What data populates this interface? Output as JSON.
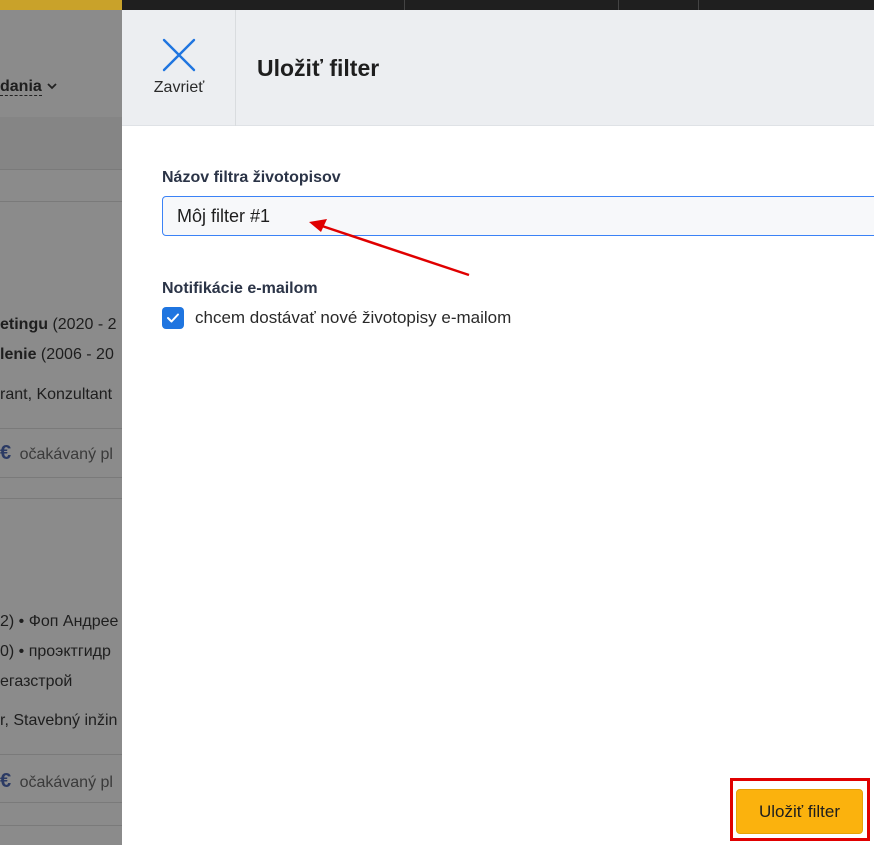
{
  "background_page": {
    "sort_label": "dania",
    "lines": [
      {
        "bold": "etingu",
        "rest": " (2020 - 2"
      },
      {
        "bold": "lenie",
        "rest": " (2006 - 20"
      },
      {
        "bold": "",
        "rest": "rant, Konzultant"
      },
      {
        "bold": "",
        "rest": "2) • Фоп Андрее"
      },
      {
        "bold": "",
        "rest": "0) • проэктгидр"
      },
      {
        "bold": "",
        "rest": "егазстрой"
      },
      {
        "bold": "",
        "rest": "r, Stavebný inžin"
      }
    ],
    "salary_label_1": "očakávaný pl",
    "salary_label_2": "očakávaný pl",
    "currency_symbol": "€"
  },
  "modal": {
    "close_label": "Zavrieť",
    "title": "Uložiť filter",
    "name_field": {
      "label": "Názov filtra životopisov",
      "value": "Môj filter #1"
    },
    "notifications": {
      "label": "Notifikácie e-mailom",
      "checkbox_label": "chcem dostávať nové životopisy e-mailom",
      "checked": true
    },
    "save_button_label": "Uložiť filter"
  },
  "colors": {
    "accent_blue": "#1f75e0",
    "save_yellow": "#fbb20d",
    "annotation_red": "#e00000"
  }
}
